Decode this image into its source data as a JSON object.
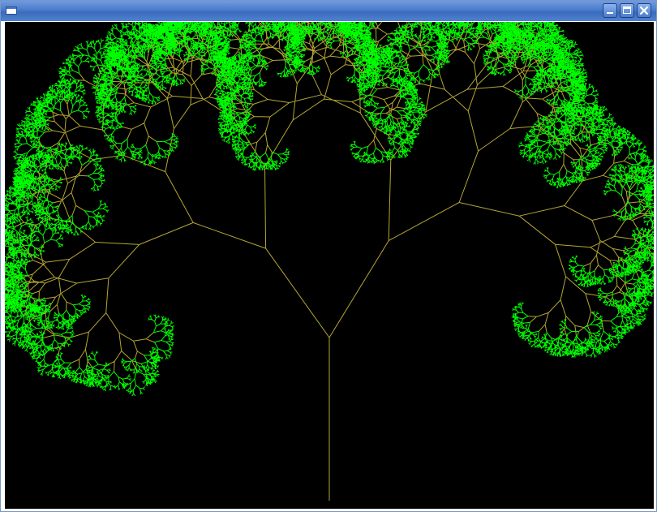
{
  "window": {
    "title": "",
    "icon": "app-window-icon",
    "controls": [
      {
        "name": "minimize",
        "icon": "minimize-icon"
      },
      {
        "name": "maximize",
        "icon": "maximize-icon"
      },
      {
        "name": "close",
        "icon": "close-icon"
      }
    ]
  },
  "fractal": {
    "description_type": "fractal-tree",
    "background_color": "#000000",
    "branch_color": "#b5a632",
    "leaf_color": "#00ff00"
  }
}
